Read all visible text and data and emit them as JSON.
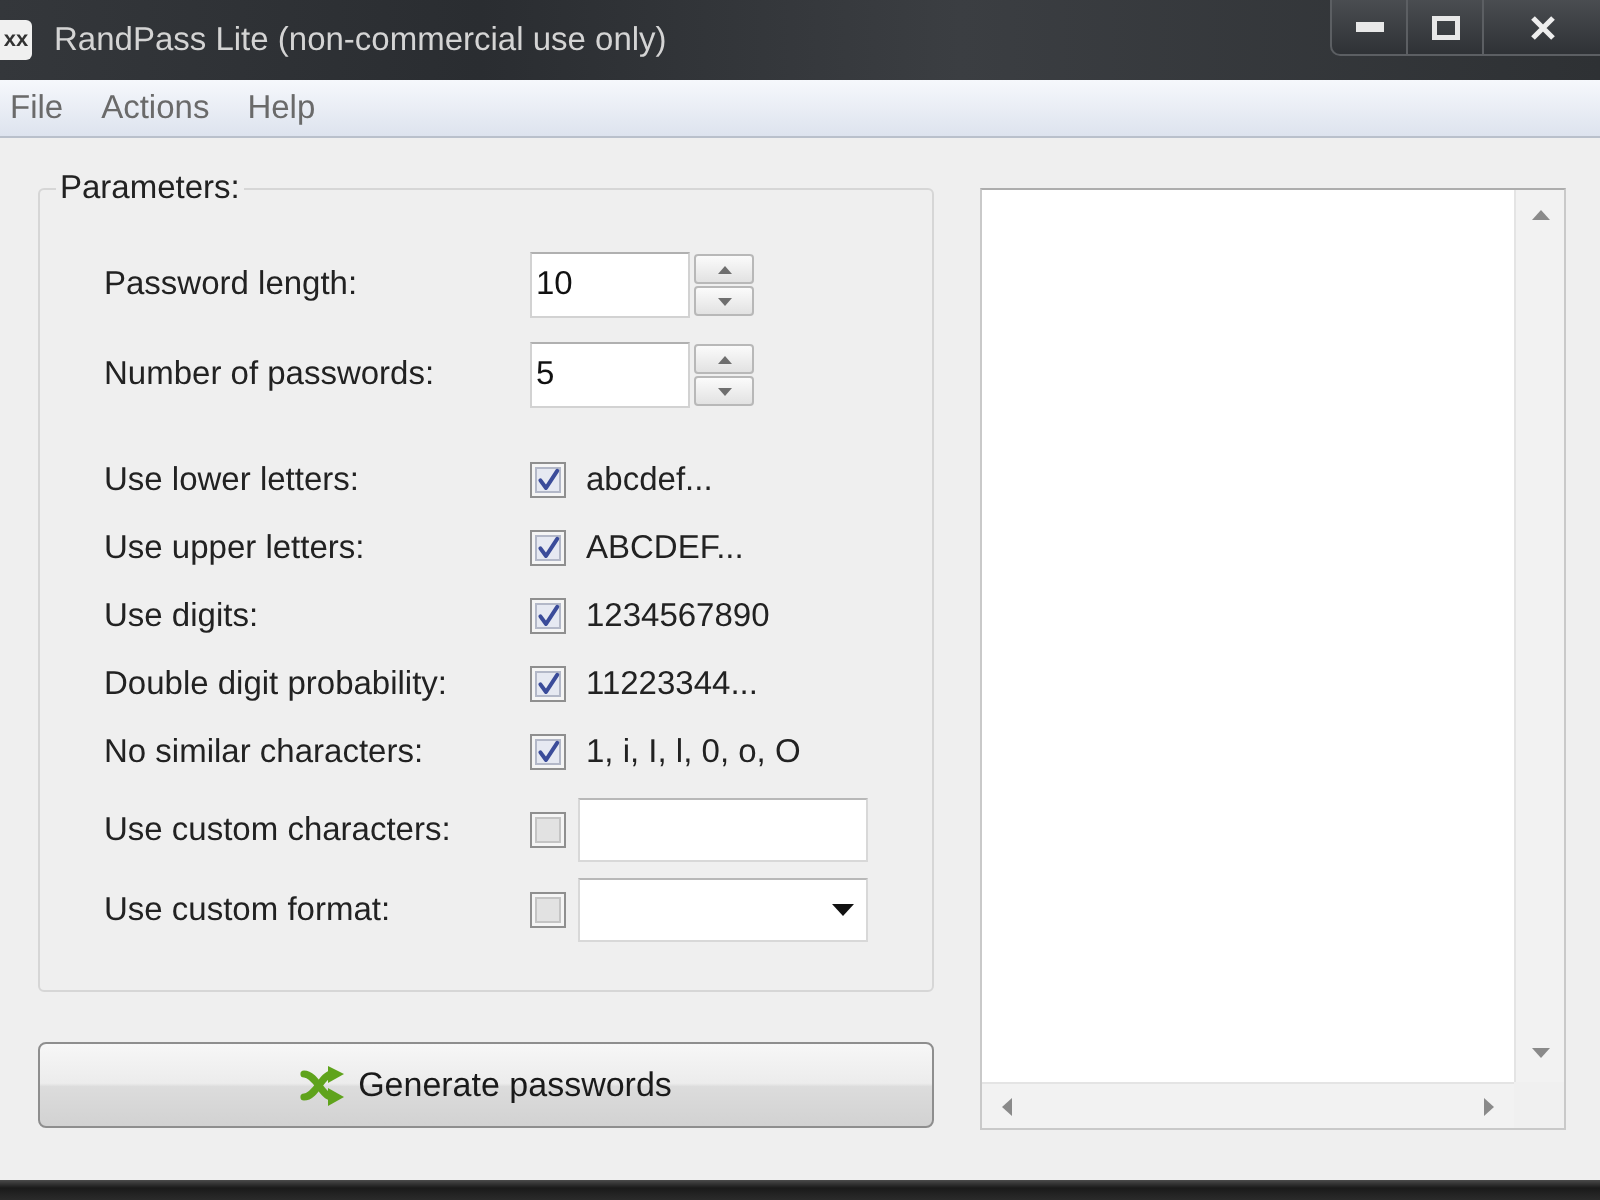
{
  "window": {
    "logo_text": "xx",
    "title": "RandPass Lite (non-commercial use only)"
  },
  "menu": [
    "File",
    "Actions",
    "Help"
  ],
  "parameters": {
    "title": "Parameters:",
    "spinners": [
      {
        "label": "Password length:",
        "value": "10"
      },
      {
        "label": "Number of passwords:",
        "value": "5"
      }
    ],
    "options": [
      {
        "kind": "sample",
        "label": "Use lower letters:",
        "checked": true,
        "sample": "abcdef..."
      },
      {
        "kind": "sample",
        "label": "Use upper letters:",
        "checked": true,
        "sample": "ABCDEF..."
      },
      {
        "kind": "sample",
        "label": "Use digits:",
        "checked": true,
        "sample": "1234567890"
      },
      {
        "kind": "sample",
        "label": "Double digit probability:",
        "checked": true,
        "sample": "11223344..."
      },
      {
        "kind": "sample",
        "label": "No similar characters:",
        "checked": true,
        "sample": "1, i, I, l, 0, o, O"
      },
      {
        "kind": "text",
        "label": "Use custom characters:",
        "checked": false
      },
      {
        "kind": "combo",
        "label": "Use custom format:",
        "checked": false
      }
    ]
  },
  "generate_button": {
    "label": "Generate passwords"
  }
}
